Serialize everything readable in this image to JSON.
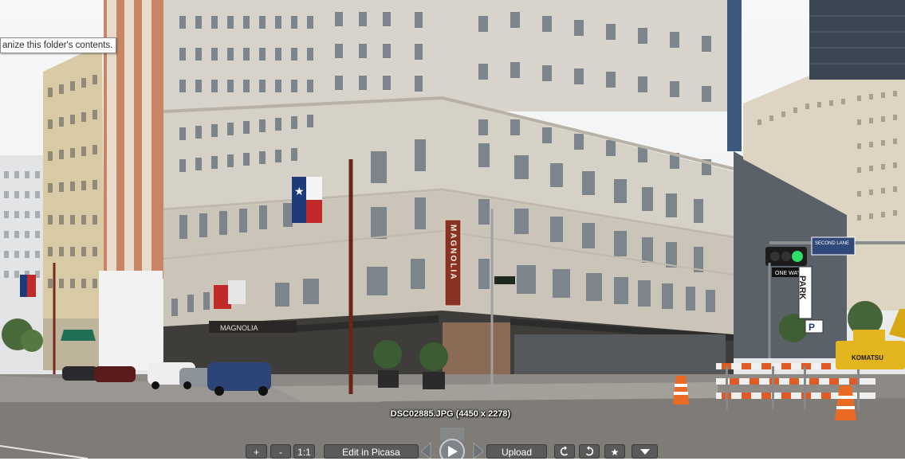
{
  "tooltip": {
    "text": "anize this folder's contents."
  },
  "viewer": {
    "caption": "DSC02885.JPG (4450 x 2278)",
    "buttons": {
      "zoom_in": "+",
      "zoom_out": "-",
      "actual_size": "1:1",
      "edit": "Edit in Picasa",
      "upload": "Upload"
    },
    "icons": {
      "play": "play-icon",
      "prev": "prev-arrow-icon",
      "next": "next-arrow-icon",
      "rotate_left": "rotate-left-icon",
      "rotate_right": "rotate-right-icon",
      "star": "star-icon",
      "more": "dropdown-arrow-icon"
    }
  },
  "photo": {
    "signs": {
      "vertical": "MAGNOLIA",
      "awning": "MAGNOLIA",
      "park": "PARK",
      "park_p": "P",
      "street": "SECOND LANE",
      "one_way": "ONE WAY",
      "komatsu": "KOMATSU"
    }
  }
}
